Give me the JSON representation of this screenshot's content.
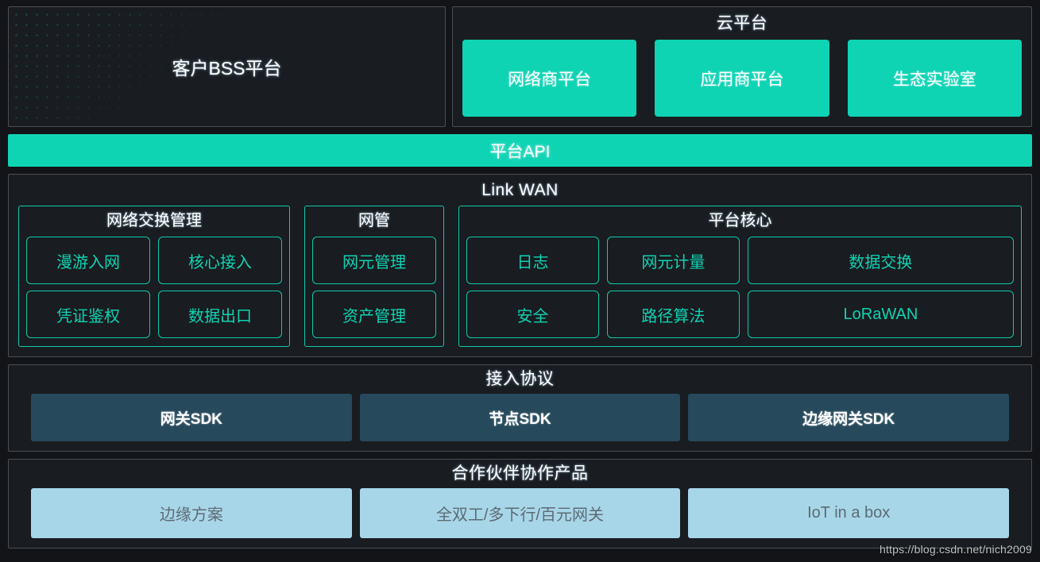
{
  "row_bss_cloud": {
    "bss": {
      "label": "客户BSS平台"
    },
    "cloud": {
      "title": "云平台",
      "boxes": [
        {
          "label": "网络商平台"
        },
        {
          "label": "应用商平台"
        },
        {
          "label": "生态实验室"
        }
      ]
    }
  },
  "api_bar": {
    "label": "平台API"
  },
  "linkwan": {
    "title": "Link WAN",
    "groups": [
      {
        "title": "网络交换管理",
        "rows": [
          [
            {
              "label": "漫游入网"
            },
            {
              "label": "核心接入"
            }
          ],
          [
            {
              "label": "凭证鉴权"
            },
            {
              "label": "数据出口"
            }
          ]
        ]
      },
      {
        "title": "网管",
        "rows": [
          [
            {
              "label": "网元管理"
            }
          ],
          [
            {
              "label": "资产管理"
            }
          ]
        ]
      },
      {
        "title": "平台核心",
        "rows": [
          [
            {
              "label": "日志"
            },
            {
              "label": "网元计量"
            },
            {
              "label": "数据交换"
            }
          ],
          [
            {
              "label": "安全"
            },
            {
              "label": "路径算法"
            },
            {
              "label": "LoRaWAN"
            }
          ]
        ]
      }
    ]
  },
  "access": {
    "title": "接入协议",
    "boxes": [
      {
        "label": "网关SDK"
      },
      {
        "label": "节点SDK"
      },
      {
        "label": "边缘网关SDK"
      }
    ]
  },
  "partner": {
    "title": "合作伙伴协作产品",
    "boxes": [
      {
        "label": "边缘方案"
      },
      {
        "label": "全双工/多下行/百元网关"
      },
      {
        "label": "IoT in a box"
      }
    ]
  },
  "watermark": {
    "text": "https://blog.csdn.net/nich2009"
  },
  "colors": {
    "background": "#121417",
    "panel_bg": "#191c20",
    "panel_border": "#4b4f55",
    "accent_teal": "#0ed4b4",
    "chip_border": "#0fc9ab",
    "chip_text": "#0fd3b3",
    "sdk_bg": "#26495c",
    "partner_bg": "#a7d6e9",
    "partner_text": "#5e6b72",
    "title_text": "#ffffff"
  }
}
